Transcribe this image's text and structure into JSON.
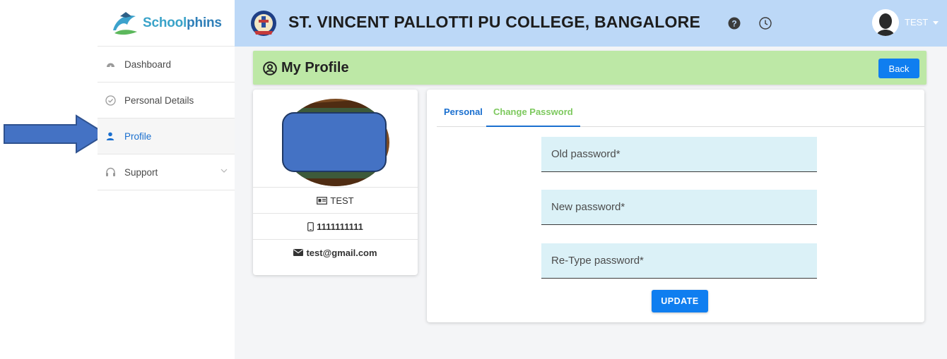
{
  "brand": {
    "part1": "School",
    "part2": "phins"
  },
  "sidebar": {
    "items": [
      {
        "label": "Dashboard",
        "icon": "dashboard-icon"
      },
      {
        "label": "Personal Details",
        "icon": "check-circle-icon"
      },
      {
        "label": "Profile",
        "icon": "user-icon",
        "active": true
      },
      {
        "label": "Support",
        "icon": "headset-icon",
        "expandable": true
      }
    ]
  },
  "header": {
    "college": "ST. VINCENT PALLOTTI PU COLLEGE, BANGALORE",
    "user": "TEST",
    "help_icon": "question-circle-icon",
    "history_icon": "clock-icon"
  },
  "page": {
    "title": "My Profile",
    "back_label": "Back"
  },
  "profile": {
    "name": "TEST",
    "phone": "1111111111",
    "email": "test@gmail.com"
  },
  "tabs": [
    {
      "label": "Personal"
    },
    {
      "label": "Change Password",
      "active": true
    }
  ],
  "form": {
    "old_placeholder": "Old password*",
    "new_placeholder": "New password*",
    "retype_placeholder": "Re-Type password*",
    "update_label": "UPDATE"
  },
  "colors": {
    "topbar": "#bcd8f7",
    "profile_bar": "#bde8a6",
    "primary": "#0f7ef0",
    "field_bg": "#dbf1f7",
    "annotation_arrow": "#4472c4"
  }
}
